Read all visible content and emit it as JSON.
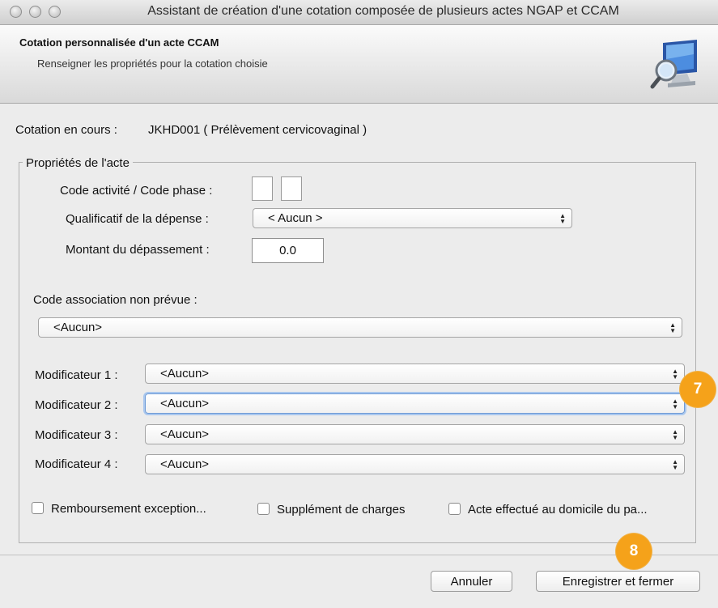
{
  "window": {
    "title": "Assistant de création d'une cotation composée de plusieurs actes NGAP et CCAM"
  },
  "header": {
    "title": "Cotation personnalisée d'un acte CCAM",
    "subtitle": "Renseigner les propriétés pour la cotation choisie",
    "icon": "monitor-magnifier-icon"
  },
  "cotation": {
    "label": "Cotation en cours :",
    "value": "JKHD001 ( Prélèvement cervicovaginal )"
  },
  "properties": {
    "legend": "Propriétés de l'acte",
    "activity_label": "Code activité / Code phase :",
    "activity_code": "",
    "phase_code": "",
    "qualificatif_label": "Qualificatif de la dépense :",
    "qualificatif_value": "< Aucun >",
    "montant_label": "Montant du dépassement :",
    "montant_value": "0.0",
    "association_label": "Code association non prévue :",
    "association_value": "<Aucun>",
    "modifiers": [
      {
        "label": "Modificateur 1 :",
        "value": "<Aucun>"
      },
      {
        "label": "Modificateur 2 :",
        "value": "<Aucun>"
      },
      {
        "label": "Modificateur 3 :",
        "value": "<Aucun>"
      },
      {
        "label": "Modificateur 4 :",
        "value": "<Aucun>"
      }
    ],
    "checkboxes": [
      {
        "label": "Remboursement exception...",
        "checked": false
      },
      {
        "label": "Supplément de charges",
        "checked": false
      },
      {
        "label": "Acte effectué au domicile du pa...",
        "checked": false
      }
    ]
  },
  "buttons": {
    "cancel": "Annuler",
    "save": "Enregistrer et fermer"
  },
  "badges": {
    "step7": "7",
    "step8": "8"
  },
  "colors": {
    "badge": "#f5a21a",
    "focus": "#6f9bd6"
  }
}
